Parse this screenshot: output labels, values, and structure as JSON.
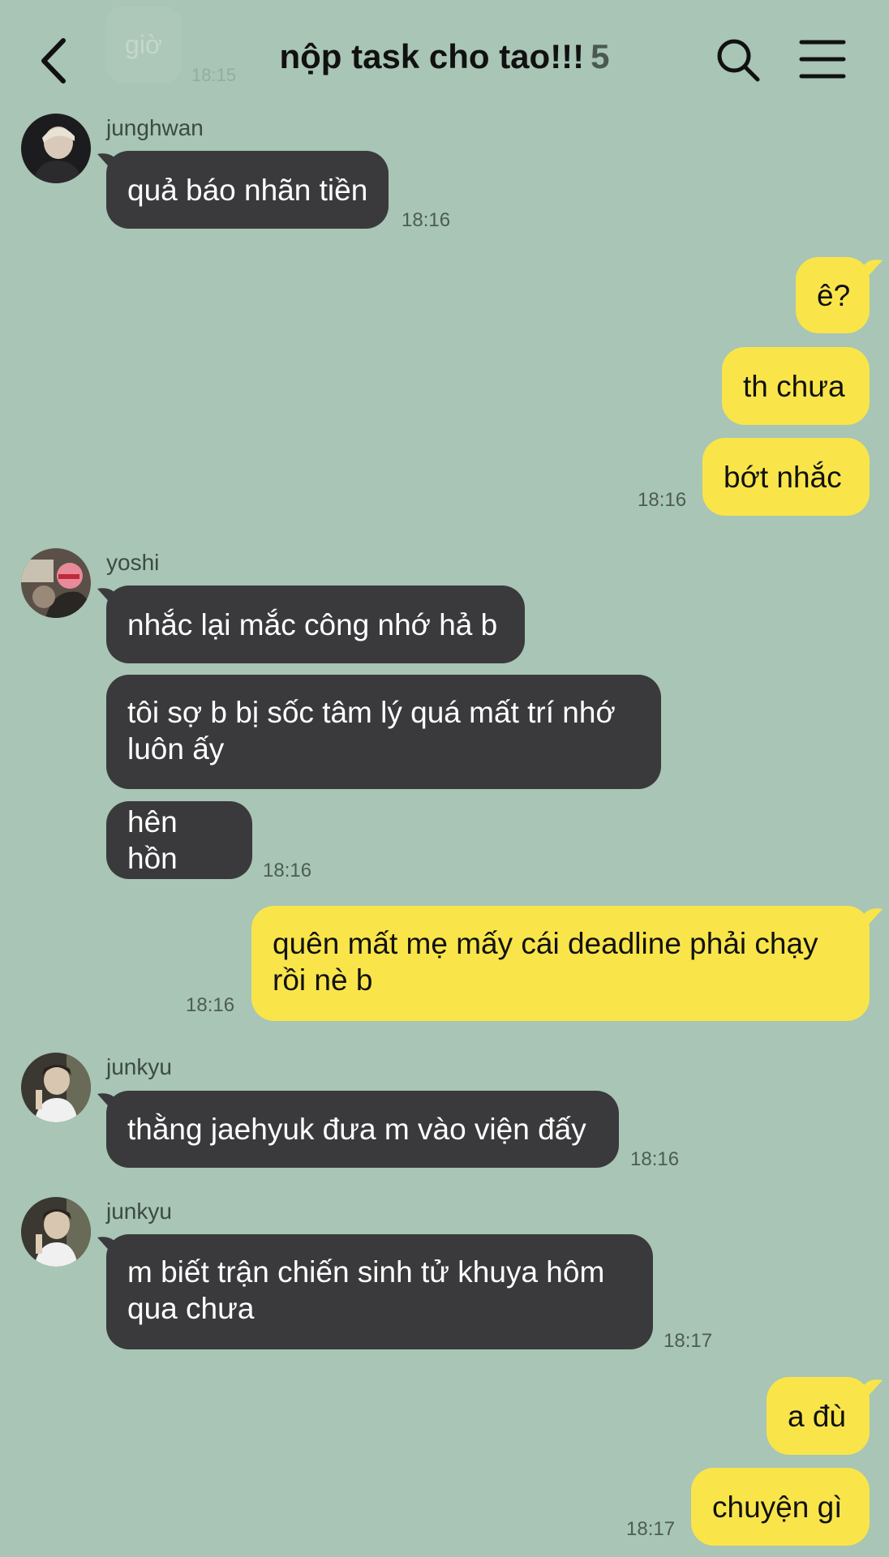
{
  "header": {
    "title": "nộp task cho tao!!!",
    "member_count": "5",
    "back_icon": "chevron-left-icon",
    "search_icon": "search-icon",
    "menu_icon": "hamburger-menu-icon",
    "ghost_text": "giờ",
    "ghost_time": "18:15"
  },
  "colors": {
    "background": "#a8c5b5",
    "incoming_bubble": "#3a3a3c",
    "outgoing_bubble": "#f9e54a"
  },
  "messages": {
    "m1": {
      "sender": "junghwan",
      "text": "quả báo nhãn tiền",
      "time": "18:16"
    },
    "m2": {
      "text": "ê?"
    },
    "m3": {
      "text": "th chưa"
    },
    "m4": {
      "text": "bớt nhắc",
      "time": "18:16"
    },
    "m5": {
      "sender": "yoshi",
      "text": "nhắc lại mắc công nhớ hả b"
    },
    "m6": {
      "line1": "tôi sợ b bị sốc tâm lý quá mất trí nhớ",
      "line2": "luôn ấy"
    },
    "m7": {
      "text": "hên hồn",
      "time": "18:16"
    },
    "m8": {
      "line1": "quên mất mẹ mấy cái deadline phải chạy",
      "line2": "rồi nè b",
      "time": "18:16"
    },
    "m9": {
      "sender": "junkyu",
      "text": "thằng jaehyuk đưa m vào viện đấy",
      "time": "18:16"
    },
    "m10": {
      "sender": "junkyu",
      "line1": "m biết trận chiến sinh tử khuya hôm",
      "line2": "qua chưa",
      "time": "18:17"
    },
    "m11": {
      "text": "a đù"
    },
    "m12": {
      "text": "chuyện gì",
      "time": "18:17"
    }
  }
}
